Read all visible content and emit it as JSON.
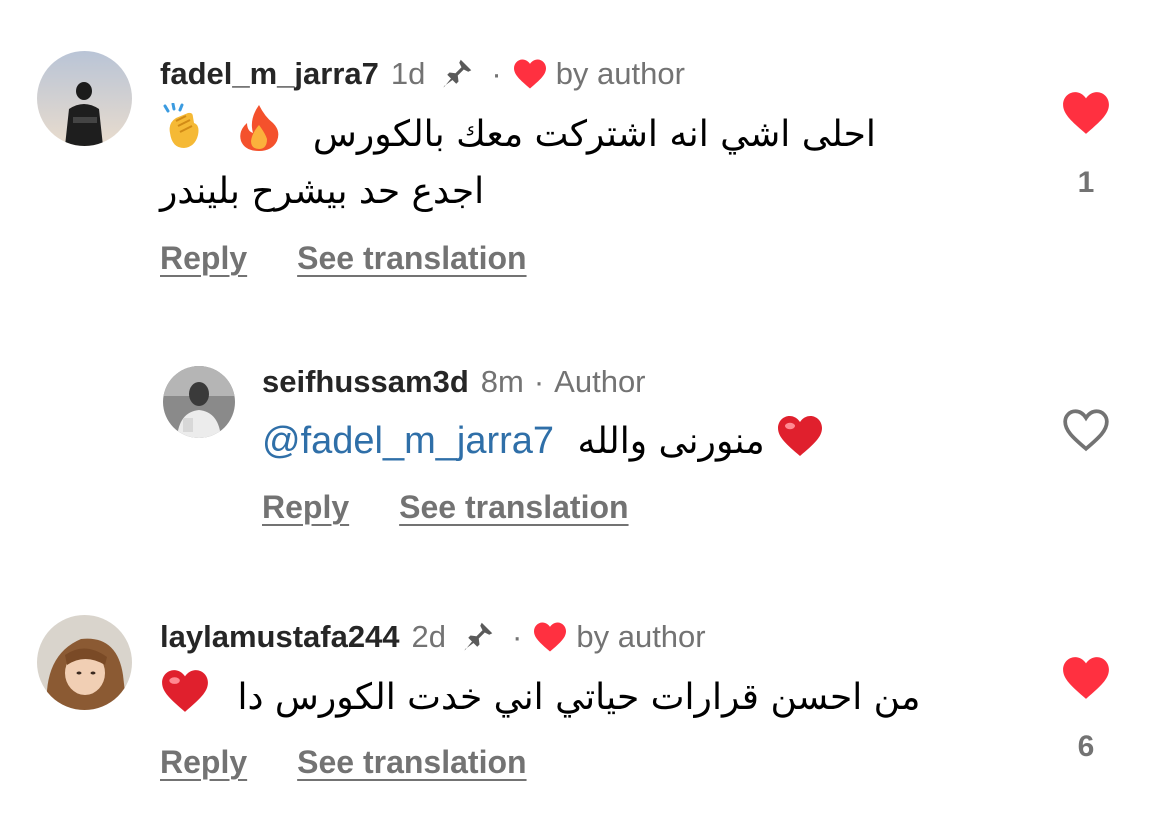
{
  "comments": [
    {
      "username": "fadel_m_jarra7",
      "time": "1d",
      "liked_by_author": "by author",
      "text_line1": "احلى اشي انه اشتركت معك بالكورس",
      "text_line2": "اجدع حد بيشرح بليندر",
      "reply_label": "Reply",
      "translate_label": "See translation",
      "like_count": "1",
      "liked": true
    },
    {
      "username": "seifhussam3d",
      "time": "8m",
      "author_label": "Author",
      "mention": "@fadel_m_jarra7",
      "text": "منورنى والله",
      "reply_label": "Reply",
      "translate_label": "See translation",
      "liked": false
    },
    {
      "username": "laylamustafa244",
      "time": "2d",
      "liked_by_author": "by author",
      "text_line1": "من احسن قرارات حياتي اني خدت الكورس دا",
      "reply_label": "Reply",
      "translate_label": "See translation",
      "like_count": "6",
      "liked": true
    }
  ],
  "colors": {
    "heart_red": "#ff3040",
    "secondary_text": "#737373",
    "mention_blue": "#2f6fa8"
  },
  "icons": [
    "pin-icon",
    "heart-icon",
    "fire-emoji",
    "clap-emoji",
    "red-heart-emoji",
    "heart-outline-icon"
  ]
}
